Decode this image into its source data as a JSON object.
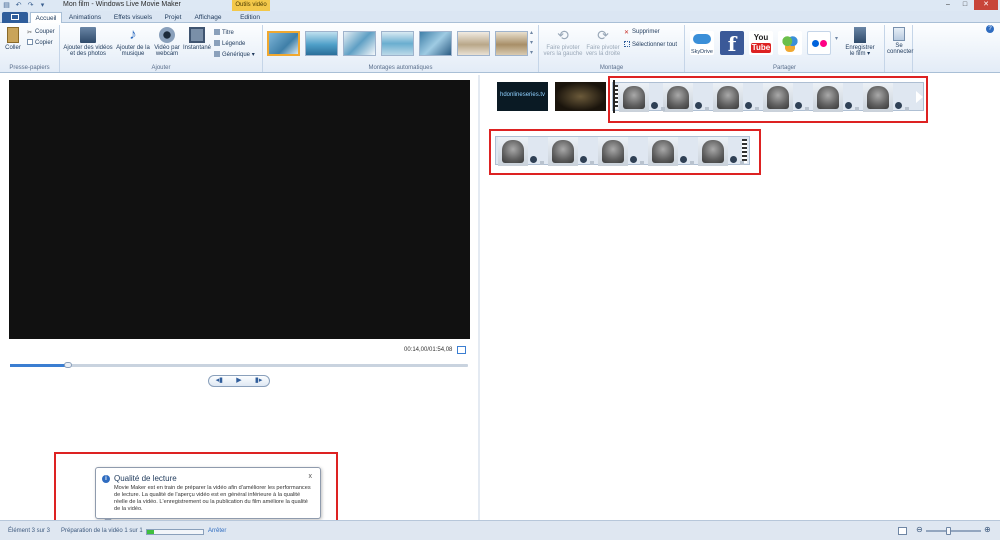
{
  "window": {
    "title": "Mon film - Windows Live Movie Maker",
    "contextual_tab": "Outils vidéo",
    "controls": [
      "–",
      "□",
      "✕"
    ]
  },
  "tabs": [
    "Accueil",
    "Animations",
    "Effets visuels",
    "Projet",
    "Affichage",
    "Edition"
  ],
  "ribbon": {
    "clipboard": {
      "paste": "Coller",
      "cut": "Couper",
      "copy": "Copier",
      "label": "Presse-papiers"
    },
    "add": {
      "add_videos": "Ajouter des vidéos et des photos",
      "add_music": "Ajouter de la musique",
      "webcam": "Vidéo par webcam",
      "snapshot": "Instantané",
      "title": "Titre",
      "caption": "Légende",
      "credits": "Générique",
      "label": "Ajouter"
    },
    "automovie": {
      "label": "Montages automatiques"
    },
    "editing": {
      "rotate_left": "Faire pivoter vers la gauche",
      "rotate_right": "Faire pivoter vers la droite",
      "delete": "Supprimer",
      "select_all": "Sélectionner tout",
      "label": "Montage"
    },
    "share": {
      "skydrive": "SkyDrive",
      "facebook": "f",
      "youtube_top": "You",
      "youtube_bottom": "Tube",
      "save_movie": "Enregistrer le film",
      "sign_in": "Se connecter",
      "label": "Partager"
    }
  },
  "preview": {
    "timecode": "00:14,00/01:54,08",
    "progress": 0.13
  },
  "storyboard": {
    "title_clip_text": "hdonlineseries.tv"
  },
  "balloon": {
    "title": "Qualité de lecture",
    "body": "Movie Maker est en train de préparer la vidéo afin d'améliorer les performances de lecture. La qualité de l'aperçu vidéo est en général inférieure à la qualité réelle de la vidéo. L'enregistrement ou la publication du film améliore la qualité de la vidéo.",
    "close": "x"
  },
  "status": {
    "item_count": "Élément 3 sur 3",
    "preparing": "Préparation de la vidéo 1 sur 1",
    "stop": "Arrêter",
    "progress": 0.12
  },
  "colors": {
    "accent": "#3b7ed1",
    "highlight": "#d22222",
    "ribbon_bg": "#e3ecf7"
  }
}
